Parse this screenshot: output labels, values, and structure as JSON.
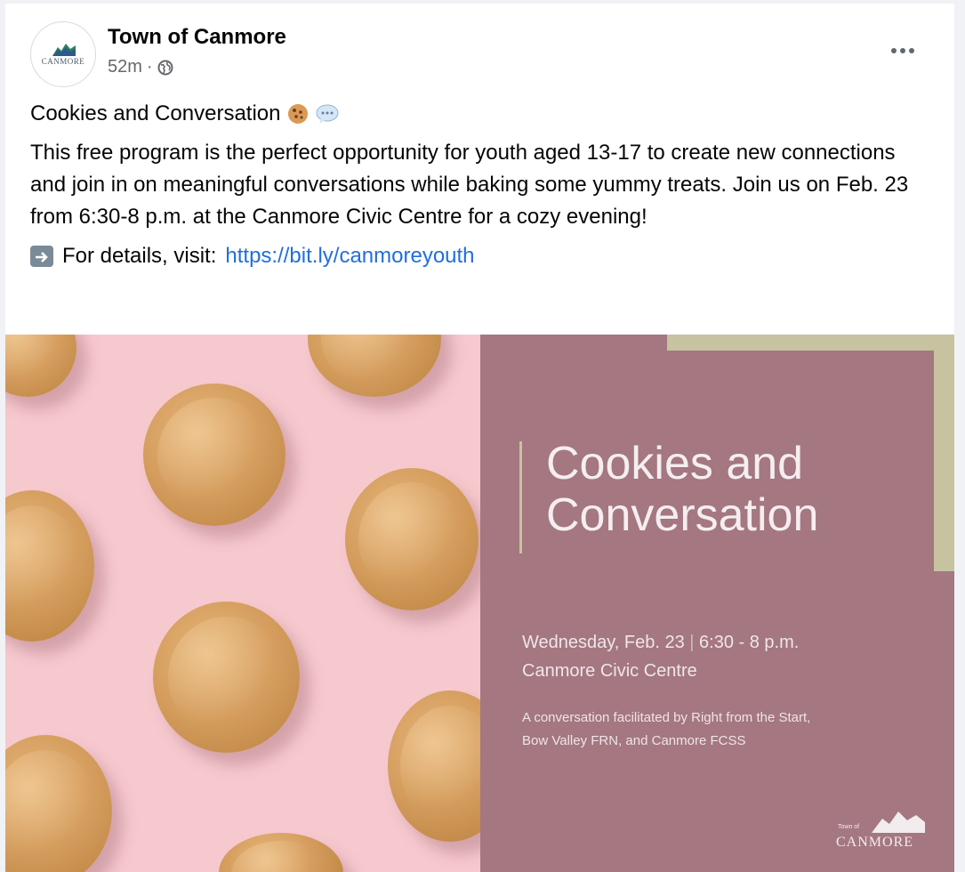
{
  "post": {
    "page_name": "Town of Canmore",
    "timestamp": "52m",
    "separator": "·",
    "privacy_icon": "globe-icon",
    "more_icon": "more-horizontal-icon",
    "avatar_logo_text": "CANMORE",
    "title": "Cookies and Conversation",
    "title_emojis": [
      "cookie-emoji",
      "speech-bubble-emoji"
    ],
    "body": "This free program is the perfect opportunity for youth aged 13-17 to create new connections and join in on meaningful conversations while baking some yummy treats. Join us on Feb. 23 from 6:30-8 p.m. at the Canmore Civic Centre for a cozy evening!",
    "details_prefix": "For details, visit:",
    "details_link": "https://bit.ly/canmoreyouth",
    "details_icon": "right-arrow-icon"
  },
  "banner": {
    "title_line1": "Cookies and",
    "title_line2": "Conversation",
    "date": "Wednesday, Feb.  23",
    "divider": "|",
    "time": "6:30  - 8 p.m.",
    "venue": "Canmore Civic Centre",
    "credit_line1": "A conversation facilitated by Right from the Start,",
    "credit_line2": "Bow Valley FRN, and Canmore FCSS",
    "logo_small": "Town of",
    "logo_text": "CANMORE",
    "colors": {
      "left_bg": "#f6c9cf",
      "right_bg": "#a47781",
      "accent": "#c7c3a0"
    }
  }
}
